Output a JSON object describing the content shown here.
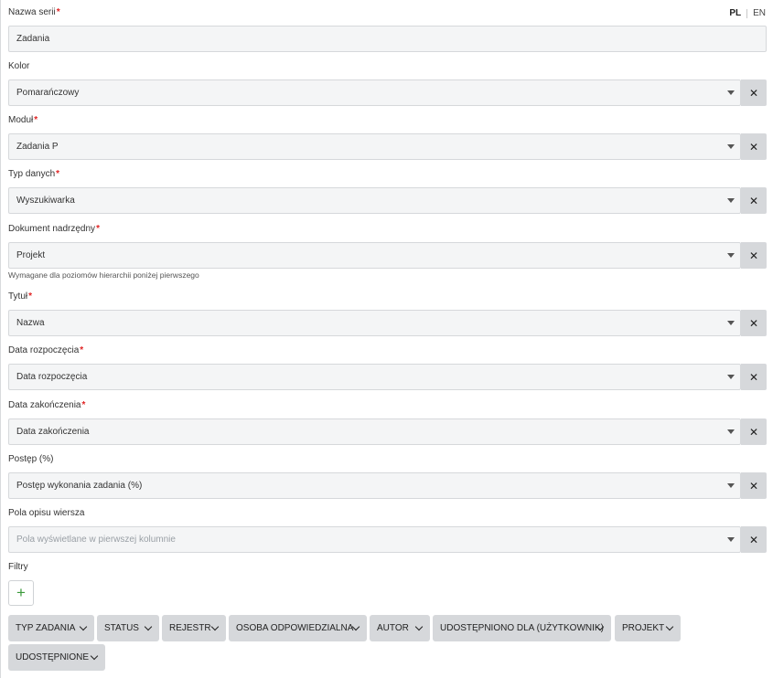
{
  "lang": {
    "pl": "PL",
    "en": "EN"
  },
  "fields": {
    "series_name": {
      "label": "Nazwa serii",
      "required": "*",
      "value": "Zadania"
    },
    "color": {
      "label": "Kolor",
      "value": "Pomarańczowy"
    },
    "module": {
      "label": "Moduł",
      "required": "*",
      "value": "Zadania P"
    },
    "data_type": {
      "label": "Typ danych",
      "required": "*",
      "value": "Wyszukiwarka"
    },
    "parent_doc": {
      "label": "Dokument nadrzędny",
      "required": "*",
      "value": "Projekt",
      "hint": "Wymagane dla poziomów hierarchii poniżej pierwszego"
    },
    "title": {
      "label": "Tytuł",
      "required": "*",
      "value": "Nazwa"
    },
    "start_date": {
      "label": "Data rozpoczęcia",
      "required": "*",
      "value": "Data rozpoczęcia"
    },
    "end_date": {
      "label": "Data zakończenia",
      "required": "*",
      "value": "Data zakończenia"
    },
    "progress": {
      "label": "Postęp (%)",
      "value": "Postęp wykonania zadania (%)"
    },
    "row_desc": {
      "label": "Pola opisu wiersza",
      "placeholder": "Pola wyświetlane w pierwszej kolumnie"
    }
  },
  "filters": {
    "label": "Filtry",
    "add": "+",
    "chips": [
      "TYP ZADANIA",
      "STATUS",
      "REJESTR",
      "OSOBA ODPOWIEDZIALNA",
      "AUTOR",
      "UDOSTĘPNIONO DLA (UŻYTKOWNIK)",
      "PROJEKT",
      "UDOSTĘPNIONE"
    ]
  },
  "clear_symbol": "✕",
  "colors": {
    "required": "#e02424",
    "field_bg": "#f4f5f6",
    "button_bg": "#d6d8db",
    "add_icon": "#3a9a3a"
  }
}
